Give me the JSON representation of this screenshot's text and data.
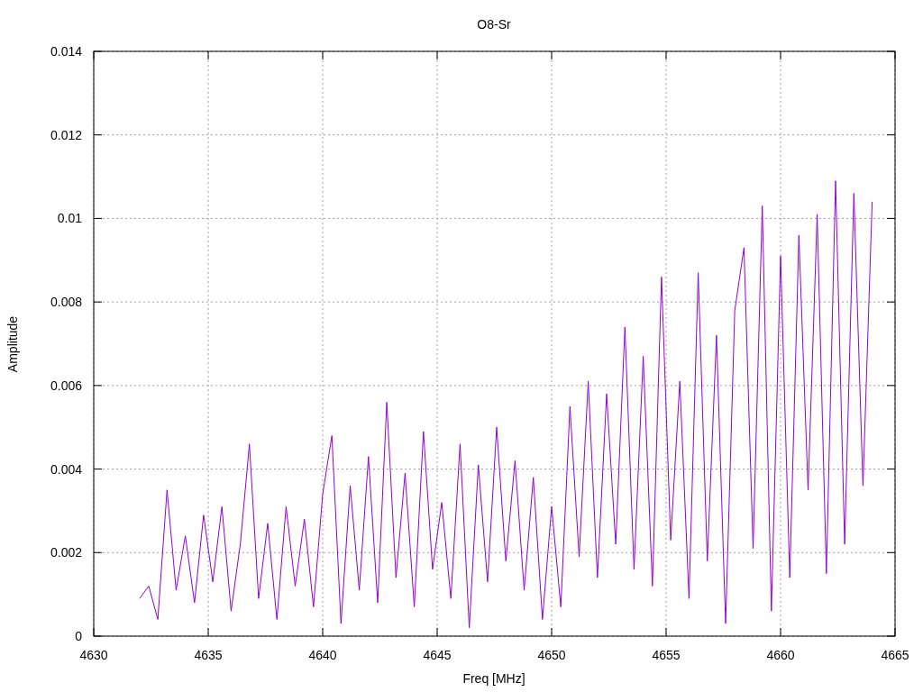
{
  "chart_data": {
    "type": "line",
    "title": "O8-Sr",
    "xlabel": "Freq [MHz]",
    "ylabel": "Amplitude",
    "xlim": [
      4630,
      4665
    ],
    "ylim": [
      0,
      0.014
    ],
    "xticks": [
      4630,
      4635,
      4640,
      4645,
      4650,
      4655,
      4660,
      4665
    ],
    "yticks": [
      0,
      0.002,
      0.004,
      0.006,
      0.008,
      0.01,
      0.012,
      0.014
    ],
    "grid": true,
    "x": [
      4632,
      4632.4,
      4632.8,
      4633.2,
      4633.6,
      4634,
      4634.4,
      4634.8,
      4635.2,
      4635.6,
      4636,
      4636.4,
      4636.8,
      4637.2,
      4637.6,
      4638,
      4638.4,
      4638.8,
      4639.2,
      4639.6,
      4640,
      4640.4,
      4640.8,
      4641.2,
      4641.6,
      4642,
      4642.4,
      4642.8,
      4643.2,
      4643.6,
      4644,
      4644.4,
      4644.8,
      4645.2,
      4645.6,
      4646,
      4646.4,
      4646.8,
      4647.2,
      4647.6,
      4648,
      4648.4,
      4648.8,
      4649.2,
      4649.6,
      4650,
      4650.4,
      4650.8,
      4651.2,
      4651.6,
      4652,
      4652.4,
      4652.8,
      4653.2,
      4653.6,
      4654,
      4654.4,
      4654.8,
      4655.2,
      4655.6,
      4656,
      4656.4,
      4656.8,
      4657.2,
      4657.6,
      4658,
      4658.4,
      4658.8,
      4659.2,
      4659.6,
      4660,
      4660.4,
      4660.8,
      4661.2,
      4661.6,
      4662,
      4662.4,
      4662.8,
      4663.2,
      4663.6,
      4664
    ],
    "series": [
      {
        "color": "#9400d3",
        "values": [
          0.0009,
          0.0012,
          0.0004,
          0.0035,
          0.0011,
          0.0024,
          0.0008,
          0.0029,
          0.0013,
          0.0031,
          0.0006,
          0.0022,
          0.0046,
          0.0009,
          0.0027,
          0.0004,
          0.0031,
          0.0012,
          0.0028,
          0.0007,
          0.0034,
          0.0048,
          0.0003,
          0.0036,
          0.0011,
          0.0043,
          0.0008,
          0.0056,
          0.0014,
          0.0039,
          0.0007,
          0.0049,
          0.0016,
          0.0032,
          0.0009,
          0.0046,
          0.0002,
          0.0041,
          0.0013,
          0.005,
          0.0018,
          0.0042,
          0.0011,
          0.0038,
          0.0004,
          0.0031,
          0.0007,
          0.0055,
          0.0019,
          0.0061,
          0.0014,
          0.0058,
          0.0022,
          0.0074,
          0.0016,
          0.0067,
          0.0012,
          0.0086,
          0.0023,
          0.0061,
          0.0009,
          0.0087,
          0.0018,
          0.0072,
          0.0003,
          0.0078,
          0.0093,
          0.0021,
          0.0103,
          0.0006,
          0.0091,
          0.0014,
          0.0096,
          0.0035,
          0.0101,
          0.0015,
          0.0109,
          0.0022,
          0.0106,
          0.0036,
          0.0104
        ]
      }
    ]
  }
}
